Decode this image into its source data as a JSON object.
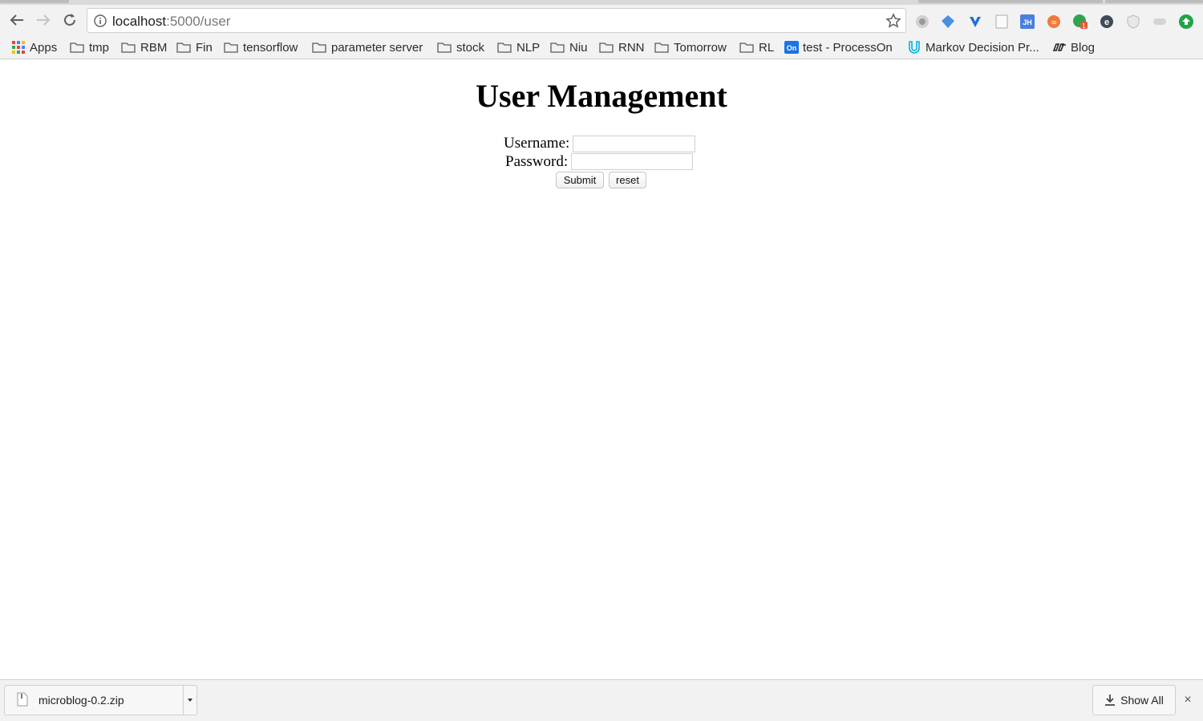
{
  "browser": {
    "url_host": "localhost",
    "url_path": ":5000/user"
  },
  "bookmarks": [
    {
      "label": "Apps",
      "icon": "apps-grid-icon"
    },
    {
      "label": "tmp",
      "icon": "folder-icon"
    },
    {
      "label": "RBM",
      "icon": "folder-icon"
    },
    {
      "label": "Fin",
      "icon": "folder-icon"
    },
    {
      "label": "tensorflow",
      "icon": "folder-icon"
    },
    {
      "label": "parameter server",
      "icon": "folder-icon"
    },
    {
      "label": "stock",
      "icon": "folder-icon"
    },
    {
      "label": "NLP",
      "icon": "folder-icon"
    },
    {
      "label": "Niu",
      "icon": "folder-icon"
    },
    {
      "label": "RNN",
      "icon": "folder-icon"
    },
    {
      "label": "Tomorrow",
      "icon": "folder-icon"
    },
    {
      "label": "RL",
      "icon": "folder-icon"
    },
    {
      "label": "test - ProcessOn",
      "icon": "processon-favicon"
    },
    {
      "label": "Markov Decision Pr...",
      "icon": "udacity-favicon"
    },
    {
      "label": "Blog",
      "icon": "blog-favicon"
    }
  ],
  "page": {
    "title": "User Management",
    "username_label": "Username:",
    "username_value": "",
    "password_label": "Password:",
    "password_value": "",
    "submit_label": "Submit",
    "reset_label": "reset"
  },
  "downloads": {
    "file_name": "microblog-0.2.zip",
    "show_all_label": "Show All",
    "close_glyph": "×"
  },
  "colors": {
    "chrome_bg": "#f2f2f2",
    "page_bg": "#ffffff",
    "ext_green": "#2ea44f",
    "ext_blue": "#3b82f6",
    "ext_orange": "#f07a3a"
  }
}
